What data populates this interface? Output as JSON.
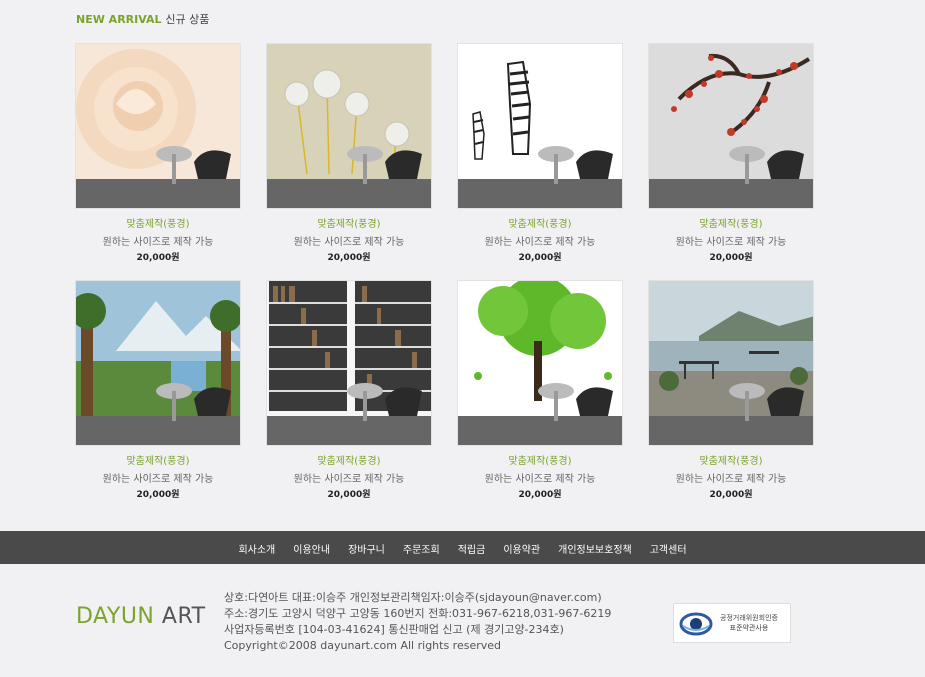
{
  "section": {
    "title_en": "NEW ARRIVAL",
    "title_ko": "신규 상품"
  },
  "products": [
    {
      "category": "맞춤제작(풍경)",
      "desc": "원하는 사이즈로 제작 가능",
      "price": "20,000원",
      "image": "rose"
    },
    {
      "category": "맞춤제작(풍경)",
      "desc": "원하는 사이즈로 제작 가능",
      "price": "20,000원",
      "image": "dandelion"
    },
    {
      "category": "맞춤제작(풍경)",
      "desc": "원하는 사이즈로 제작 가능",
      "price": "20,000원",
      "image": "zebra"
    },
    {
      "category": "맞춤제작(풍경)",
      "desc": "원하는 사이즈로 제작 가능",
      "price": "20,000원",
      "image": "plum-blossom"
    },
    {
      "category": "맞춤제작(풍경)",
      "desc": "원하는 사이즈로 제작 가능",
      "price": "20,000원",
      "image": "waterfall-landscape"
    },
    {
      "category": "맞춤제작(풍경)",
      "desc": "원하는 사이즈로 제작 가능",
      "price": "20,000원",
      "image": "bookshelf"
    },
    {
      "category": "맞춤제작(풍경)",
      "desc": "원하는 사이즈로 제작 가능",
      "price": "20,000원",
      "image": "green-tree"
    },
    {
      "category": "맞춤제작(풍경)",
      "desc": "원하는 사이즈로 제작 가능",
      "price": "20,000원",
      "image": "lake-terrace"
    }
  ],
  "footer_nav": [
    "회사소개",
    "이용안내",
    "장바구니",
    "주문조회",
    "적립금",
    "이용약관",
    "개인정보보호정책",
    "고객센터"
  ],
  "logo": {
    "part1": "DAYUN",
    "part2": " ART"
  },
  "company_info": [
    "상호:다연아트  대표:이승주  개인정보관리책임자:이승주(sjdayoun@naver.com)",
    "주소:경기도 고양시 덕양구 고양동 160번지 전화:031-967-6218,031-967-6219",
    "사업자등록번호 [104-03-41624] 통신판매업 신고 (제 경기고양-234호)",
    "Copyright©2008 dayunart.com All rights reserved"
  ],
  "badge": {
    "line1": "공정거래위원회인증",
    "line2": "표준약관사용"
  },
  "colors": {
    "accent": "#7aa42b",
    "footer_bar": "#4a4a4a",
    "background": "#f1f0f2"
  }
}
